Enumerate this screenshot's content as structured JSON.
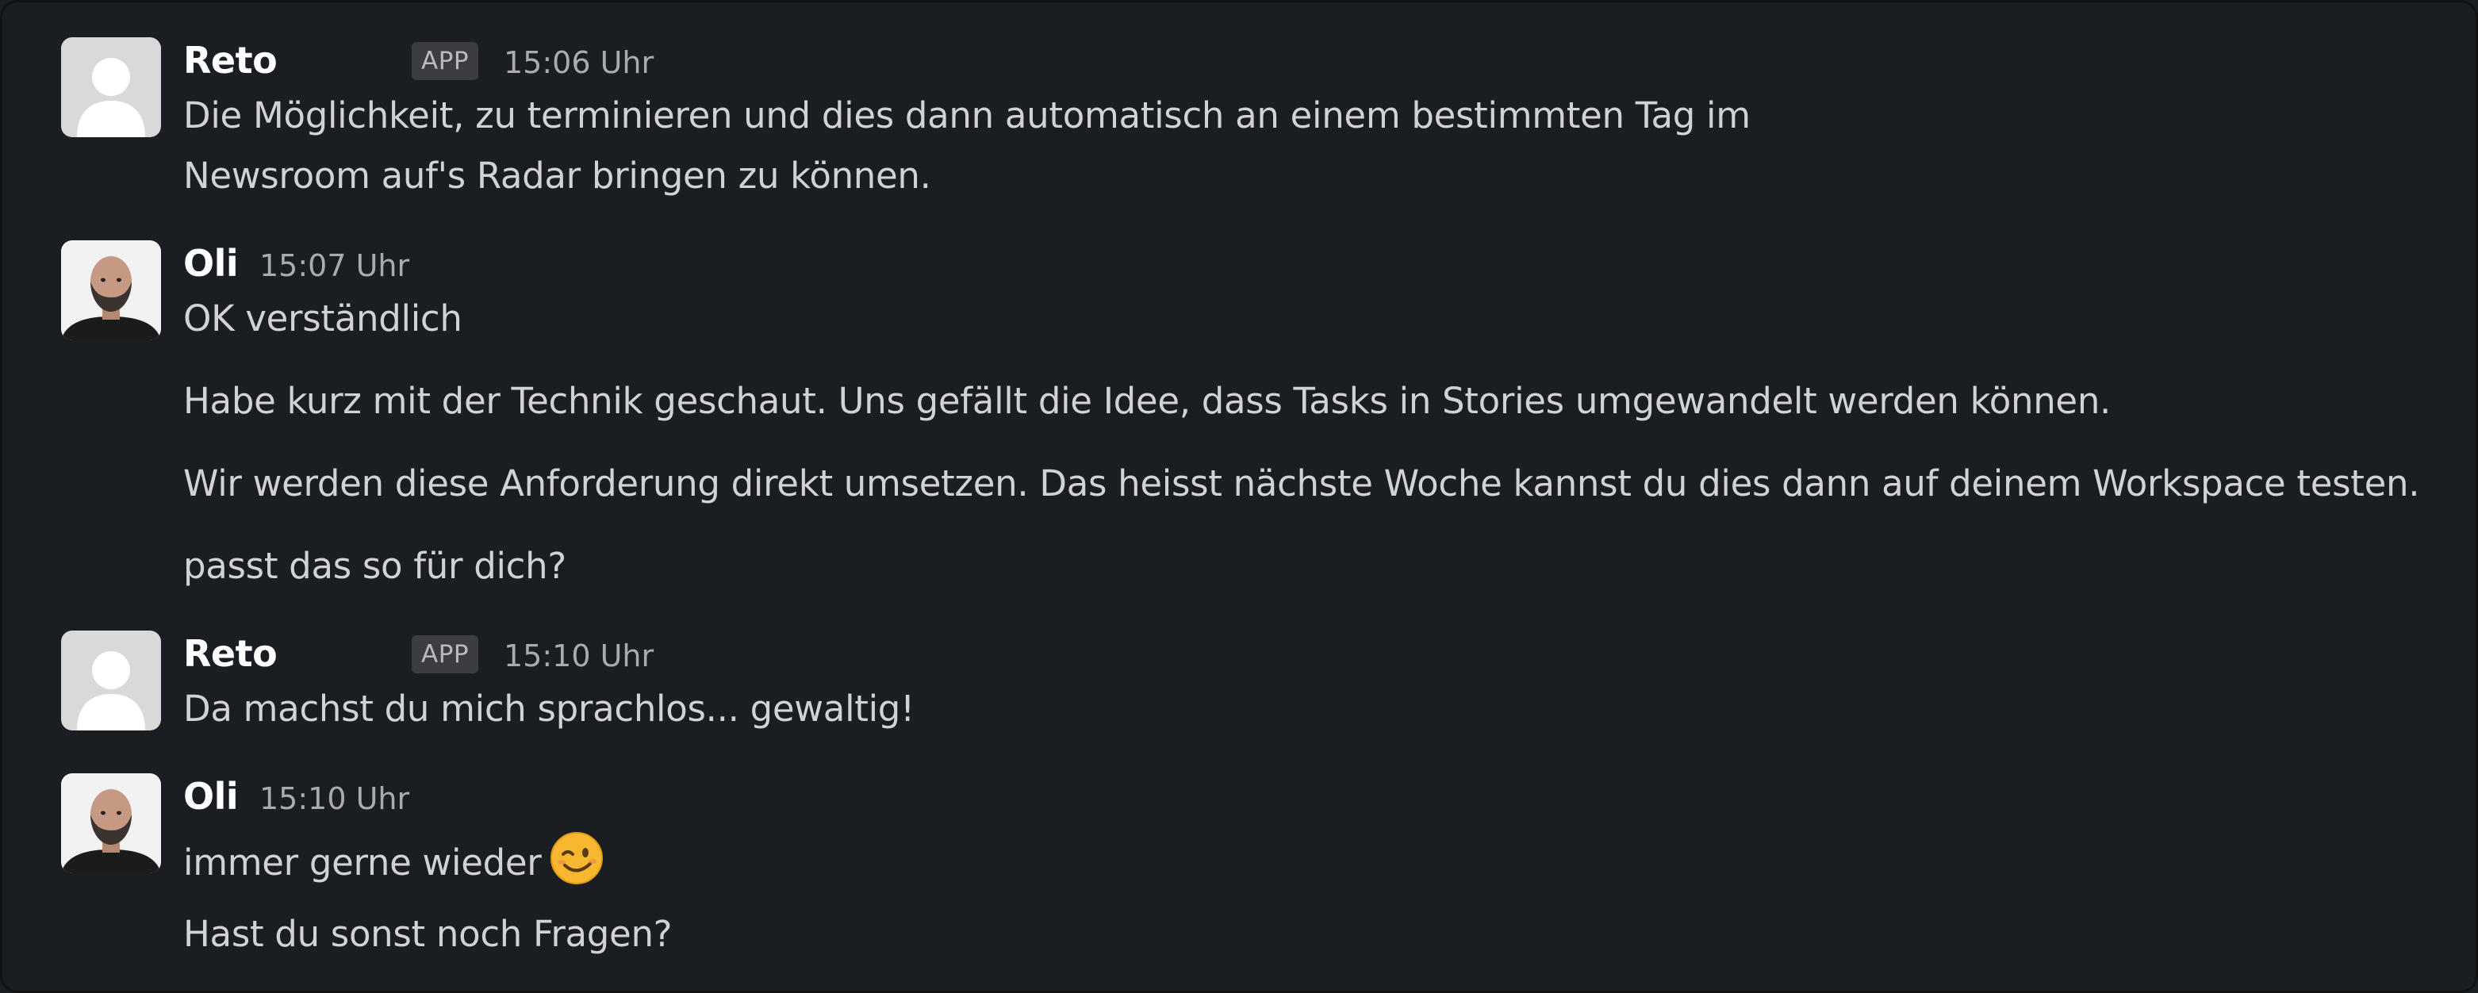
{
  "messages": [
    {
      "author": "Reto",
      "badge": "APP",
      "time": "15:06 Uhr",
      "lines": [
        "Die Möglichkeit, zu terminieren und dies dann automatisch an einem bestimmten Tag im",
        "Newsroom auf's Radar bringen zu können."
      ]
    },
    {
      "author": "Oli",
      "time": "15:07 Uhr",
      "lines": [
        "OK verständlich",
        "Habe kurz mit der Technik geschaut. Uns gefällt die Idee, dass Tasks in Stories umgewandelt werden können.",
        "Wir werden diese Anforderung direkt umsetzen. Das heisst nächste Woche kannst du dies dann auf deinem Workspace testen.",
        "passt das so für dich?"
      ]
    },
    {
      "author": "Reto",
      "badge": "APP",
      "time": "15:10 Uhr",
      "lines": [
        "Da machst du mich sprachlos... gewaltig!"
      ]
    },
    {
      "author": "Oli",
      "time": "15:10 Uhr",
      "lines": [
        "immer gerne wieder",
        "Hast du sonst noch Fragen?"
      ],
      "emoji": "winking-face-icon"
    }
  ],
  "colors": {
    "background": "#1a1d21",
    "name": "#ffffff",
    "text": "#d1d2d3",
    "time": "#ababad",
    "badge_bg": "#3b3d42"
  }
}
